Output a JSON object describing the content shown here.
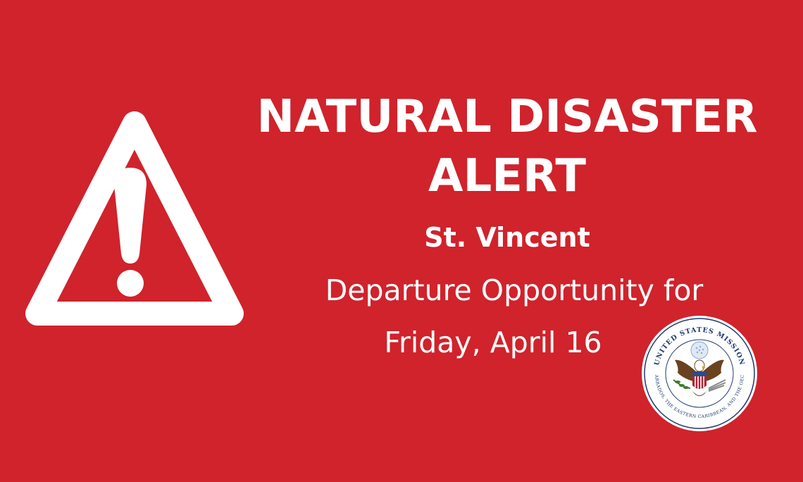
{
  "alert": {
    "title_line1": "NATURAL DISASTER",
    "title_line2": "ALERT",
    "location": "St. Vincent",
    "detail_line1": "Departure Opportunity for",
    "detail_line2": "Friday, April 16"
  },
  "seal": {
    "top_text": "UNITED STATES MISSION",
    "bottom_text": "BARBADOS, THE EASTERN CARIBBEAN, AND THE OECS"
  },
  "colors": {
    "background": "#D0232C",
    "text": "#FFFFFF",
    "seal_ring": "#1E3A6E",
    "eagle": "#6B4220",
    "shield_red": "#B22234",
    "shield_blue": "#2A4C8C",
    "olive_branch": "#3E7A2E"
  },
  "icons": [
    "warning-triangle-icon",
    "exclamation-icon",
    "eagle-icon"
  ]
}
